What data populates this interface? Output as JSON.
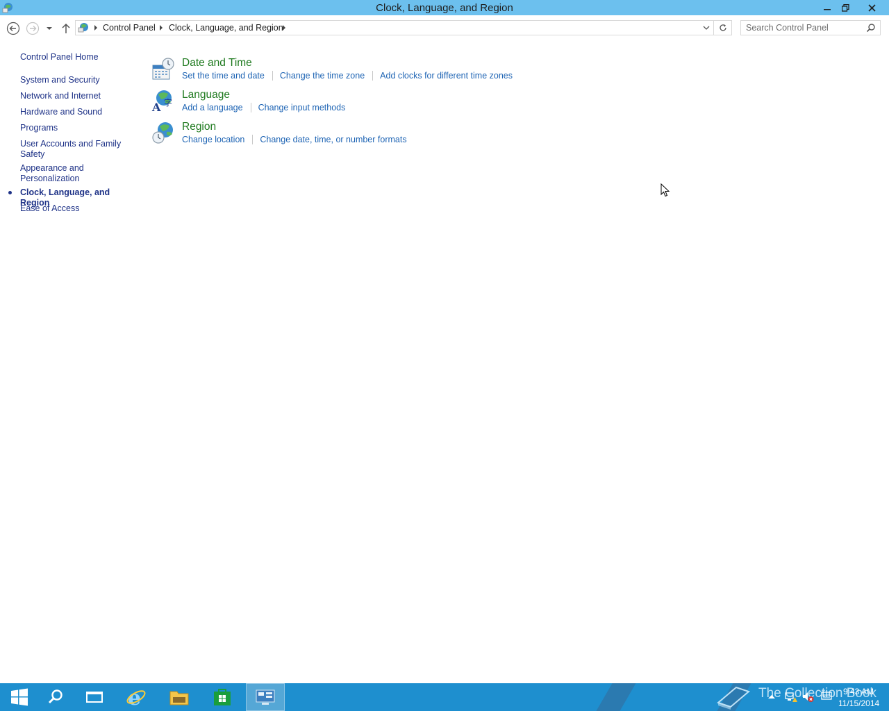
{
  "window": {
    "title": "Clock, Language, and Region"
  },
  "navigation": {
    "breadcrumb": [
      "Control Panel",
      "Clock, Language, and Region"
    ],
    "search_placeholder": "Search Control Panel"
  },
  "sidebar": {
    "items": [
      {
        "label": "Control Panel Home"
      },
      {
        "label": "System and Security"
      },
      {
        "label": "Network and Internet"
      },
      {
        "label": "Hardware and Sound"
      },
      {
        "label": "Programs"
      },
      {
        "label": "User Accounts and Family Safety"
      },
      {
        "label": "Appearance and Personalization"
      },
      {
        "label": "Clock, Language, and Region",
        "active": true
      },
      {
        "label": "Ease of Access"
      }
    ]
  },
  "categories": [
    {
      "title": "Date and Time",
      "icon": "date-time-icon",
      "links": [
        "Set the time and date",
        "Change the time zone",
        "Add clocks for different time zones"
      ]
    },
    {
      "title": "Language",
      "icon": "language-icon",
      "links": [
        "Add a language",
        "Change input methods"
      ]
    },
    {
      "title": "Region",
      "icon": "region-icon",
      "links": [
        "Change location",
        "Change date, time, or number formats"
      ]
    }
  ],
  "taskbar": {
    "watermark": "The Collection Book",
    "clock_time": "9:43 AM",
    "clock_date": "11/15/2014"
  },
  "colors": {
    "titlebar": "#6cc0ee",
    "taskbar": "#1e8fcf",
    "link": "#1e64b4",
    "category_title": "#1f7a1f",
    "sidebar_text": "#1e3287"
  }
}
